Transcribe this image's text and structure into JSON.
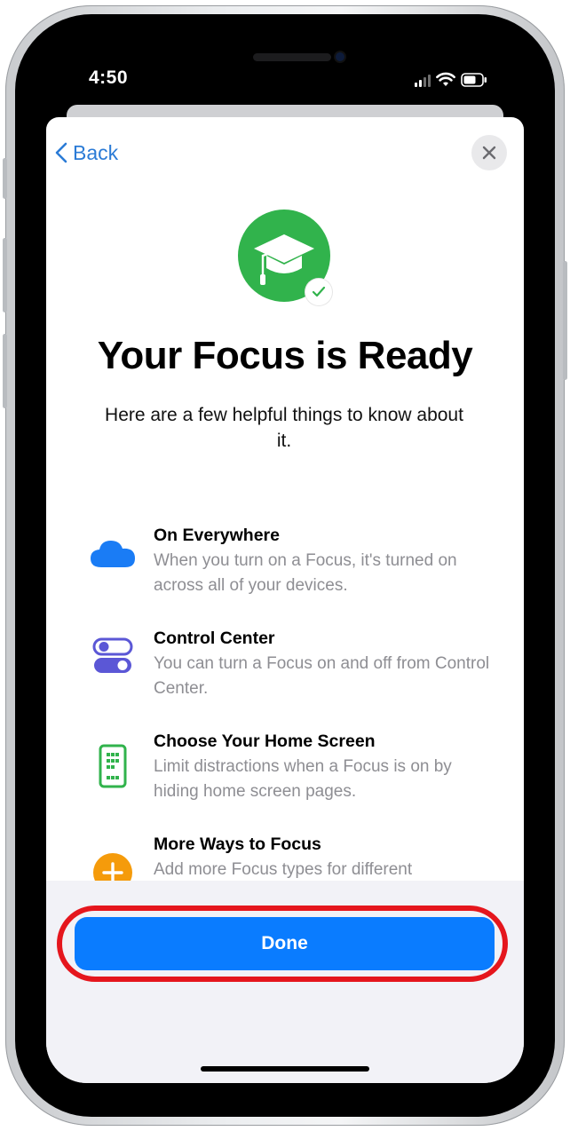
{
  "status_bar": {
    "time": "4:50"
  },
  "nav": {
    "back_label": "Back"
  },
  "header": {
    "title": "Your Focus is Ready",
    "subtitle": "Here are a few helpful things to know about it."
  },
  "icons": {
    "focus": "graduation-cap-icon",
    "badge": "checkmark-icon"
  },
  "features": [
    {
      "title": "On Everywhere",
      "description": "When you turn on a Focus, it's turned on across all of your devices.",
      "icon": "cloud-icon",
      "color": "#1a7cf5"
    },
    {
      "title": "Control Center",
      "description": "You can turn a Focus on and off from Control Center.",
      "icon": "toggle-icon",
      "color": "#5b57d6"
    },
    {
      "title": "Choose Your Home Screen",
      "description": "Limit distractions when a Focus is on by hiding home screen pages.",
      "icon": "phone-icon",
      "color": "#31b34c"
    },
    {
      "title": "More Ways to Focus",
      "description": "Add more Focus types for different",
      "icon": "plus-circle-icon",
      "color": "#f59b0b"
    }
  ],
  "footer": {
    "done_label": "Done"
  },
  "colors": {
    "accent": "#0a7cff",
    "focus_green": "#31b34c",
    "highlight_red": "#e5161d"
  }
}
